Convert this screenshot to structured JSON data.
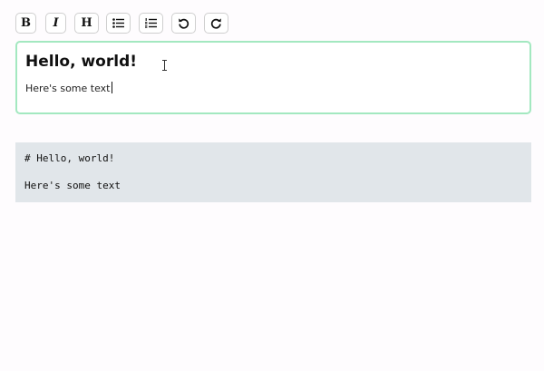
{
  "toolbar": {
    "bold_label": "B",
    "italic_label": "I",
    "heading_label": "H",
    "buttons": [
      "bold",
      "italic",
      "heading",
      "bullet-list-icon",
      "ordered-list-icon",
      "undo-icon",
      "redo-icon"
    ]
  },
  "editor": {
    "heading": "Hello, world!",
    "paragraph": "Here's some text",
    "focus_border_color": "#a3e8c0"
  },
  "preview": {
    "line1": "# Hello, world!",
    "line2": "Here's some text",
    "background": "#e1e6ea"
  }
}
